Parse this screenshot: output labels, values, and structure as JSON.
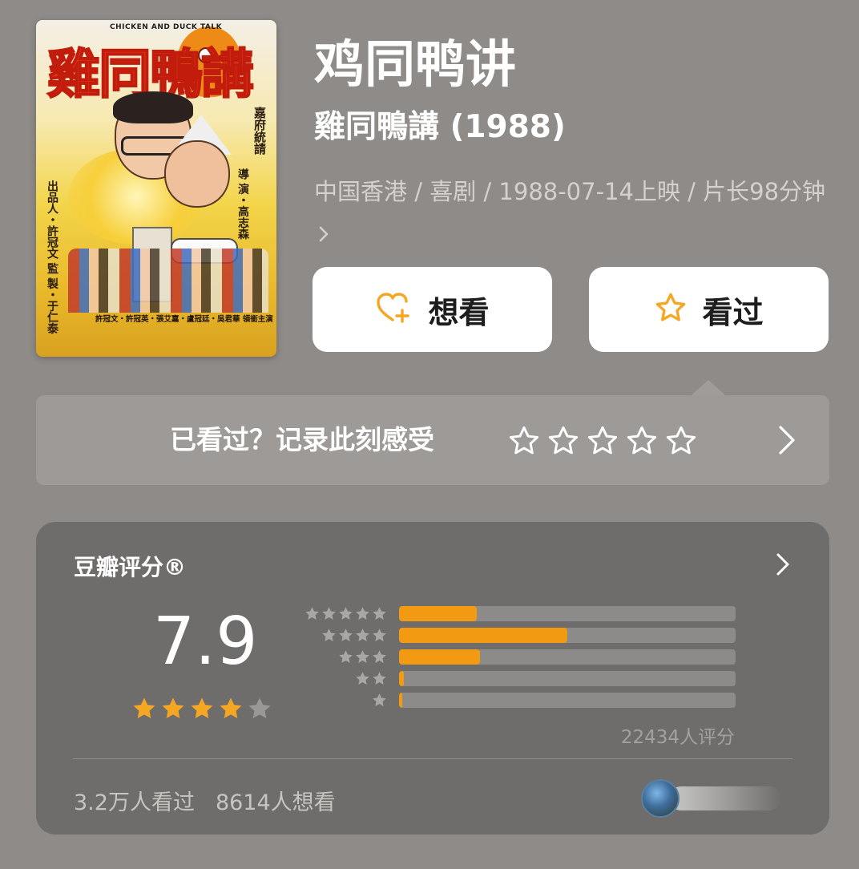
{
  "poster": {
    "title_en": "CHICKEN AND DUCK TALK",
    "title_zh": "雞同鴨講",
    "credit_right": "嘉府統請",
    "credit_director": "導 演・高志森",
    "credit_left": "出品人・許冠文 監 製・于仁泰",
    "credit_bottom": "許冠文・許冠英・張艾嘉・盧冠廷・吳君華 領銜主演"
  },
  "movie": {
    "title": "鸡同鸭讲",
    "original_title": "雞同鴨講 (1988)",
    "meta_line": "中国香港 / 喜剧 / 1988-07-14上映 / 片长98分钟",
    "meta_chevron": ">"
  },
  "actions": {
    "want_label": "想看",
    "seen_label": "看过"
  },
  "record": {
    "prompt": "已看过？记录此刻感受",
    "stars_count": 5
  },
  "rating": {
    "header": "豆瓣评分®",
    "score": "7.9",
    "stars_filled": 4,
    "stars_total": 5,
    "distribution": [
      {
        "stars": 5,
        "fraction": 0.23
      },
      {
        "stars": 4,
        "fraction": 0.5
      },
      {
        "stars": 3,
        "fraction": 0.24
      },
      {
        "stars": 2,
        "fraction": 0.015
      },
      {
        "stars": 1,
        "fraction": 0.005
      }
    ],
    "count_text": "22434人评分",
    "watched_text": "3.2万人看过",
    "wish_text": "8614人想看"
  },
  "colors": {
    "background": "#8e8b88",
    "panel": "#6f6d6b",
    "accent_orange": "#f29a12",
    "star_gold": "#f5a623"
  }
}
